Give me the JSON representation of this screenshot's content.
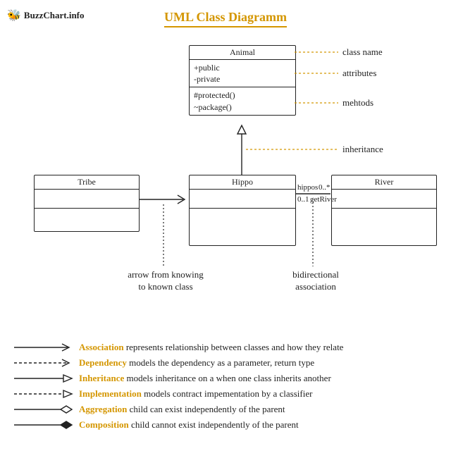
{
  "logo": {
    "icon_name": "bee-icon",
    "text": "BuzzChart.info"
  },
  "title": "UML Class Diagramm",
  "animal": {
    "name": "Animal",
    "attr1": "+public",
    "attr2": "-private",
    "meth1": "#protected()",
    "meth2": "~package()"
  },
  "classes": {
    "tribe": "Tribe",
    "hippo": "Hippo",
    "river": "River"
  },
  "annotations": {
    "class_name": "class name",
    "attributes": "attributes",
    "methods": "mehtods",
    "inheritance": "inheritance",
    "assoc_role1": "hippos",
    "assoc_mult1": "0..*",
    "assoc_role2": "getRiver",
    "assoc_mult2": "0..1"
  },
  "notes": {
    "arrow_note_l1": "arrow from knowing",
    "arrow_note_l2": "to known class",
    "bidi_l1": "bidirectional",
    "bidi_l2": "association"
  },
  "legend": {
    "association": {
      "term": "Association",
      "desc": " represents relationship between classes and how they relate"
    },
    "dependency": {
      "term": "Dependency",
      "desc": " models the dependency as a parameter, return type"
    },
    "inheritance": {
      "term": "Inheritance",
      "desc": " models inheritance on a when one class inherits another"
    },
    "implementation": {
      "term": "Implementation",
      "desc": " models contract impementation by a classifier"
    },
    "aggregation": {
      "term": "Aggregation",
      "desc": " child can exist independently of the parent"
    },
    "composition": {
      "term": "Composition",
      "desc": " child cannot exist independently of the parent"
    }
  }
}
